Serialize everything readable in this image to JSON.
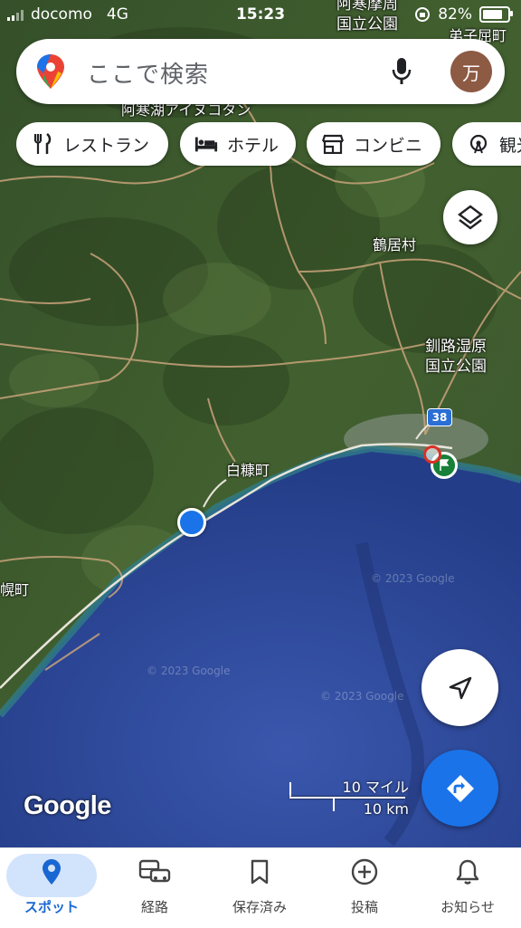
{
  "status_bar": {
    "carrier": "docomo",
    "network": "4G",
    "time": "15:23",
    "battery": "82%",
    "battery_level": 0.82
  },
  "search": {
    "placeholder": "ここで検索",
    "avatar_initial": "万"
  },
  "chips": [
    {
      "label": "レストラン",
      "icon": "restaurant-icon"
    },
    {
      "label": "ホテル",
      "icon": "hotel-icon"
    },
    {
      "label": "コンビニ",
      "icon": "store-icon"
    },
    {
      "label": "観光",
      "icon": "attraction-icon"
    }
  ],
  "map": {
    "labels": {
      "lake_akan": "阿寒湖アイヌコタン",
      "akan_park": "阿寒摩周\n国立公園",
      "teshikaga": "弟子屈町",
      "tsurui": "鶴居村",
      "kushiro_wetland": "釧路湿原\n国立公園",
      "shiranuka": "白糠町",
      "urahoro": "幌町",
      "route": "38"
    },
    "watermark": "© 2023 Google",
    "google_logo": "Google",
    "scale": {
      "miles": "10 マイル",
      "km": "10 km"
    },
    "colors": {
      "sea": "#2d4a9c",
      "land": "#3e5a2c",
      "location_dot": "#1a73e8",
      "road": "#c8a37a"
    }
  },
  "bottom_nav": [
    {
      "label": "スポット",
      "icon": "location-pin-icon",
      "active": true
    },
    {
      "label": "経路",
      "icon": "commute-icon",
      "active": false
    },
    {
      "label": "保存済み",
      "icon": "bookmark-icon",
      "active": false
    },
    {
      "label": "投稿",
      "icon": "add-circle-icon",
      "active": false
    },
    {
      "label": "お知らせ",
      "icon": "bell-icon",
      "active": false
    }
  ]
}
